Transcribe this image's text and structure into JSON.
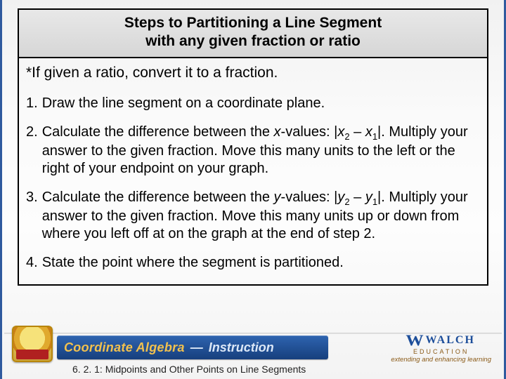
{
  "title": {
    "line1": "Steps to Partitioning a Line Segment",
    "line2": "with any given fraction or ratio"
  },
  "note": "*If given a ratio, convert it to a fraction.",
  "steps": {
    "s1": {
      "num": "1.",
      "text": "Draw the line segment on a coordinate plane."
    },
    "s2": {
      "num": "2.",
      "pre": "Calculate the difference between the ",
      "xlabel": "x",
      "post1": "-values: |",
      "x2": "x",
      "sub2": "2",
      "mid": " – ",
      "x1": "x",
      "sub1": "1",
      "post2": "|. Multiply your answer to the given fraction.  Move this many units to the left or the right of your endpoint on your graph."
    },
    "s3": {
      "num": "3.",
      "pre": "Calculate the difference between the ",
      "ylabel": "y",
      "post1": "-values: |",
      "y2": "y",
      "sub2": "2",
      "mid": " – ",
      "y1": "y",
      "sub1": "1",
      "post2": "|. Multiply your answer to the given fraction.  Move this many units up or down from where you left off at on the graph at the end of step 2."
    },
    "s4": {
      "num": "4.",
      "text": "State the point where the segment is partitioned."
    }
  },
  "footer": {
    "course": "Coordinate Algebra",
    "dash": "—",
    "section": "Instruction",
    "breadcrumb": "6. 2. 1: Midpoints and Other Points on Line Segments",
    "brand_w": "W",
    "brand_name": "WALCH",
    "brand_edu": "EDUCATION",
    "brand_tag": "extending and enhancing learning"
  }
}
